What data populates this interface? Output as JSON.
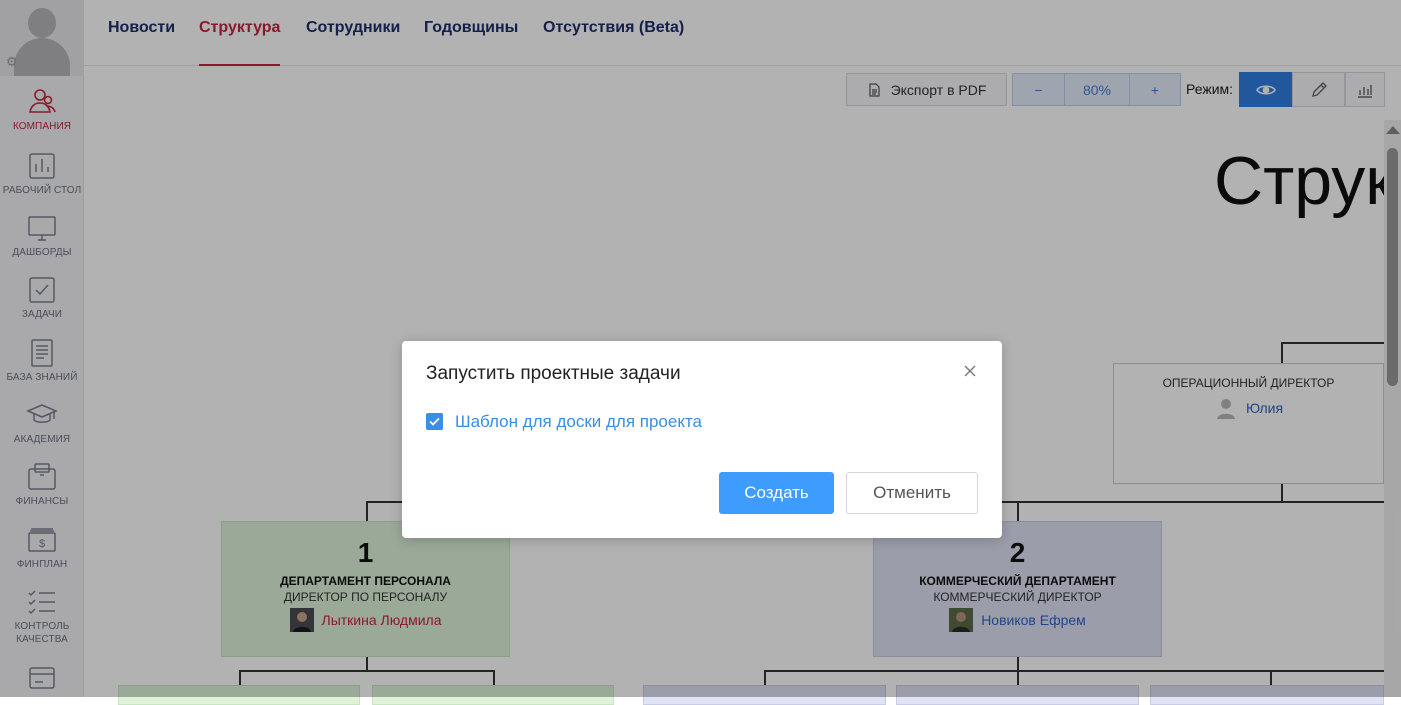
{
  "sidebar": {
    "items": [
      {
        "label": "КОМПАНИЯ",
        "icon": "company-icon"
      },
      {
        "label": "РАБОЧИЙ СТОЛ",
        "icon": "desktop-chart-icon"
      },
      {
        "label": "ДАШБОРДЫ",
        "icon": "monitor-icon"
      },
      {
        "label": "ЗАДАЧИ",
        "icon": "checkbox-icon"
      },
      {
        "label": "БАЗА ЗНАНИЙ",
        "icon": "document-icon"
      },
      {
        "label": "АКАДЕМИЯ",
        "icon": "graduation-cap-icon"
      },
      {
        "label": "ФИНАНСЫ",
        "icon": "wallet-icon"
      },
      {
        "label": "ФИНПЛАН",
        "icon": "money-icon"
      },
      {
        "label": "КОНТРОЛЬ КАЧЕСТВА",
        "icon": "checklist-icon"
      },
      {
        "label": "",
        "icon": "card-icon"
      }
    ]
  },
  "tabs": [
    "Новости",
    "Структура",
    "Сотрудники",
    "Годовщины",
    "Отсутствия (Beta)"
  ],
  "toolbar": {
    "export_label": "Экспорт в PDF",
    "zoom_minus": "−",
    "zoom_value": "80%",
    "zoom_plus": "+",
    "mode_label": "Режим:"
  },
  "canvas": {
    "title": "Струк",
    "ops": {
      "role": "ОПЕРАЦИОННЫЙ ДИРЕКТОР",
      "person": "Юлия"
    },
    "dept1": {
      "num": "1",
      "name": "ДЕПАРТАМЕНТ ПЕРСОНАЛА",
      "role": "ДИРЕКТОР ПО ПЕРСОНАЛУ",
      "person": "Лыткина Людмила"
    },
    "dept2": {
      "num": "2",
      "name": "КОММЕРЧЕСКИЙ ДЕПАРТАМЕНТ",
      "role": "КОММЕРЧЕСКИЙ ДИРЕКТОР",
      "person": "Новиков Ефрем"
    }
  },
  "modal": {
    "title": "Запустить проектные задачи",
    "checkbox_label": "Шаблон для доски для проекта",
    "create_label": "Создать",
    "cancel_label": "Отменить"
  },
  "colors": {
    "accent": "#c6243f",
    "nav_text": "#1f2e6b",
    "primary_button": "#3e9cff",
    "mode_active": "#2f7de1",
    "dept1_bg": "#dff3db",
    "dept2_bg": "#dfe3f4"
  }
}
